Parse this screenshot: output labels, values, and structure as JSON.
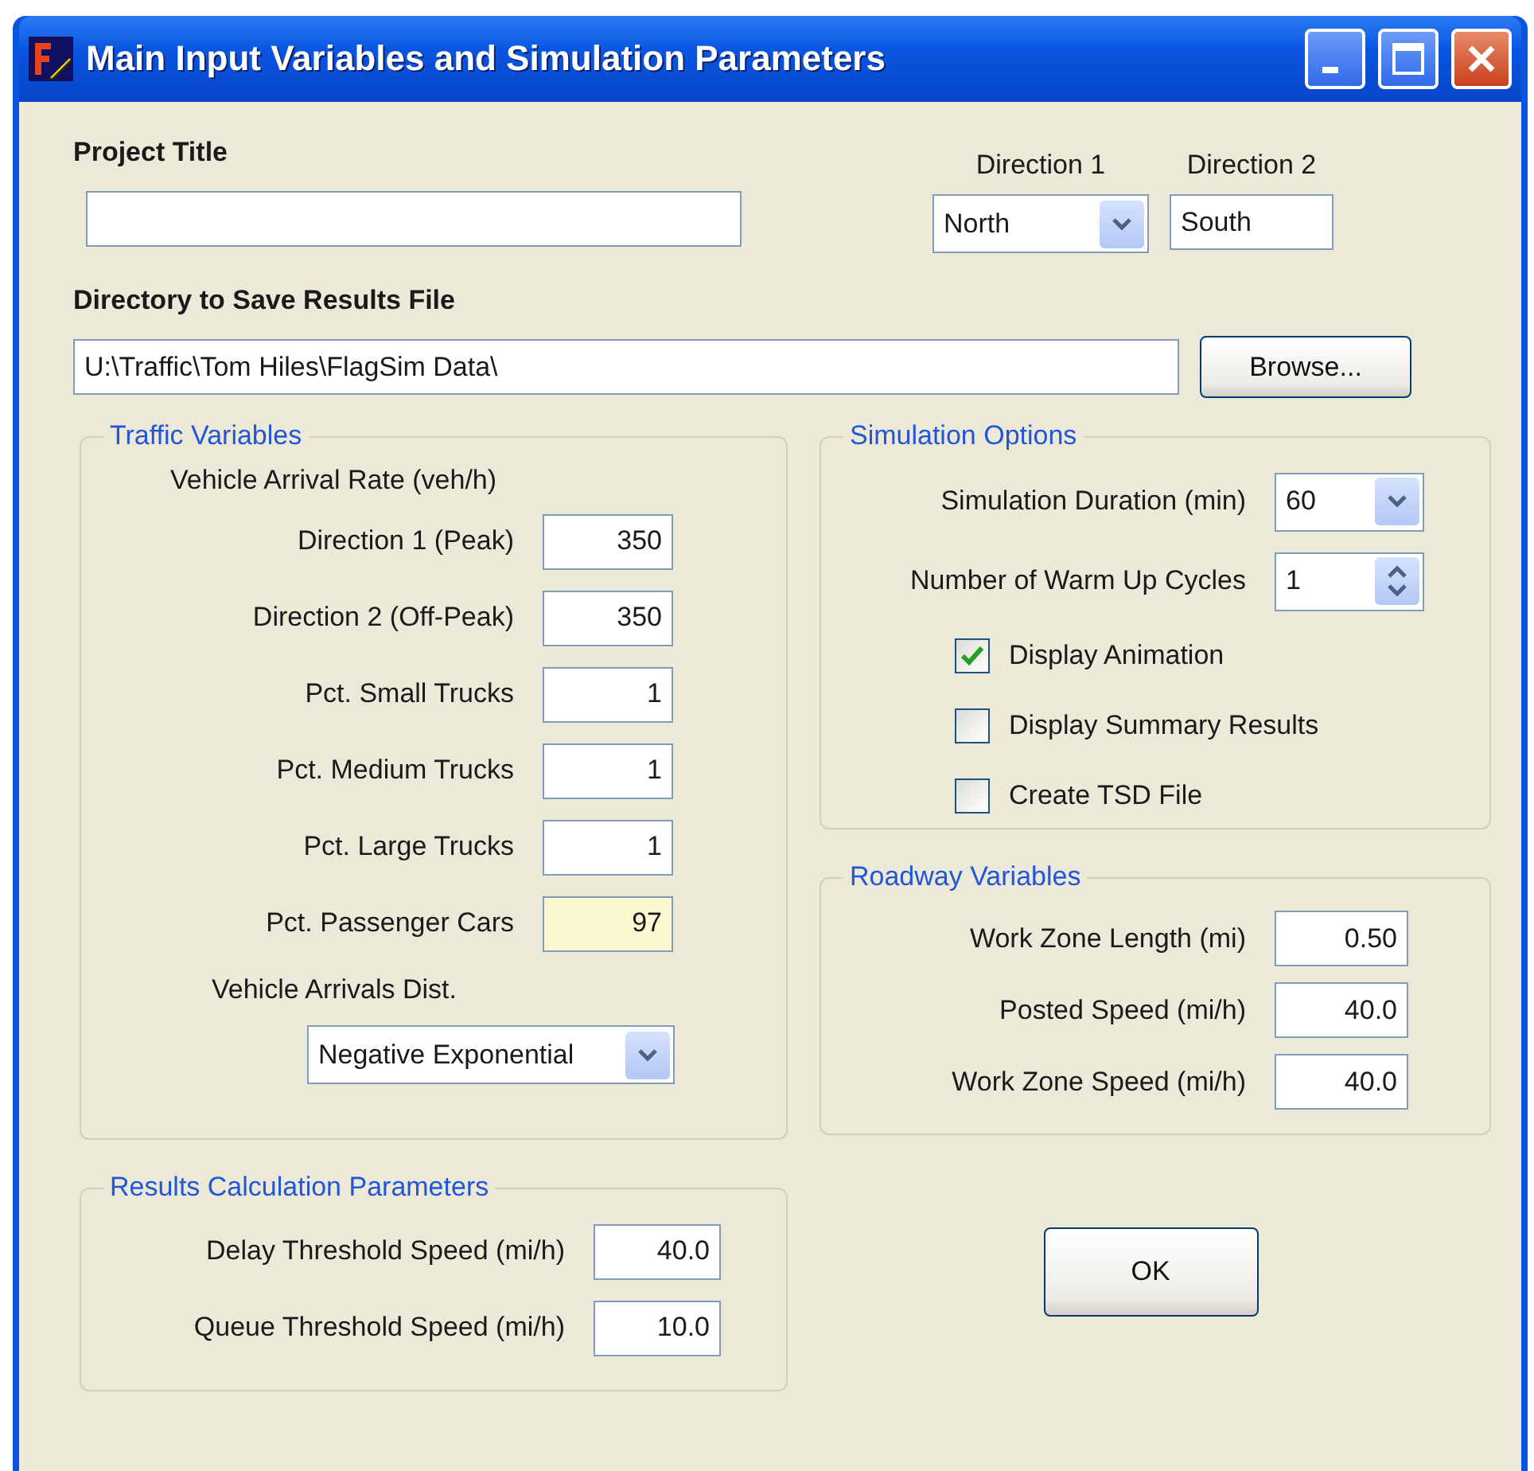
{
  "window": {
    "title": "Main Input Variables and Simulation Parameters"
  },
  "project_title": {
    "label": "Project Title"
  },
  "directions": [
    {
      "label": "Direction 1",
      "value": "North",
      "kind": "dropdown"
    },
    {
      "label": "Direction 2",
      "value": "South",
      "kind": "text"
    }
  ],
  "directory": {
    "label": "Directory to Save Results File",
    "value": "U:\\Traffic\\Tom Hiles\\FlagSim Data\\",
    "button": "Browse..."
  },
  "traffic_variables": {
    "title": "Traffic Variables",
    "subtitle": "Vehicle Arrival Rate (veh/h)",
    "fields": [
      {
        "label": "Direction 1 (Peak)",
        "value": "350",
        "readonly": false
      },
      {
        "label": "Direction 2 (Off-Peak)",
        "value": "350",
        "readonly": false
      },
      {
        "label": "Pct. Small Trucks",
        "value": "1",
        "readonly": false
      },
      {
        "label": "Pct. Medium Trucks",
        "value": "1",
        "readonly": false
      },
      {
        "label": "Pct. Large Trucks",
        "value": "1",
        "readonly": false
      },
      {
        "label": "Pct. Passenger Cars",
        "value": "97",
        "readonly": true
      }
    ],
    "dist_label": "Vehicle Arrivals Dist.",
    "dist_value": "Negative Exponential"
  },
  "simulation_options": {
    "title": "Simulation Options",
    "fields": [
      {
        "label": "Simulation Duration (min)",
        "value": "60",
        "kind": "dropdown"
      },
      {
        "label": "Number of Warm Up Cycles",
        "value": "1",
        "kind": "spinner"
      }
    ],
    "checkboxes": [
      {
        "label": "Display Animation",
        "checked": true
      },
      {
        "label": "Display Summary Results",
        "checked": false
      },
      {
        "label": "Create TSD File",
        "checked": false
      }
    ]
  },
  "roadway_variables": {
    "title": "Roadway Variables",
    "fields": [
      {
        "label": "Work Zone Length (mi)",
        "value": "0.50"
      },
      {
        "label": "Posted Speed (mi/h)",
        "value": "40.0"
      },
      {
        "label": "Work Zone Speed (mi/h)",
        "value": "40.0"
      }
    ]
  },
  "results_parameters": {
    "title": "Results Calculation Parameters",
    "fields": [
      {
        "label": "Delay Threshold Speed (mi/h)",
        "value": "40.0"
      },
      {
        "label": "Queue Threshold Speed (mi/h)",
        "value": "10.0"
      }
    ]
  },
  "ok_button": "OK"
}
